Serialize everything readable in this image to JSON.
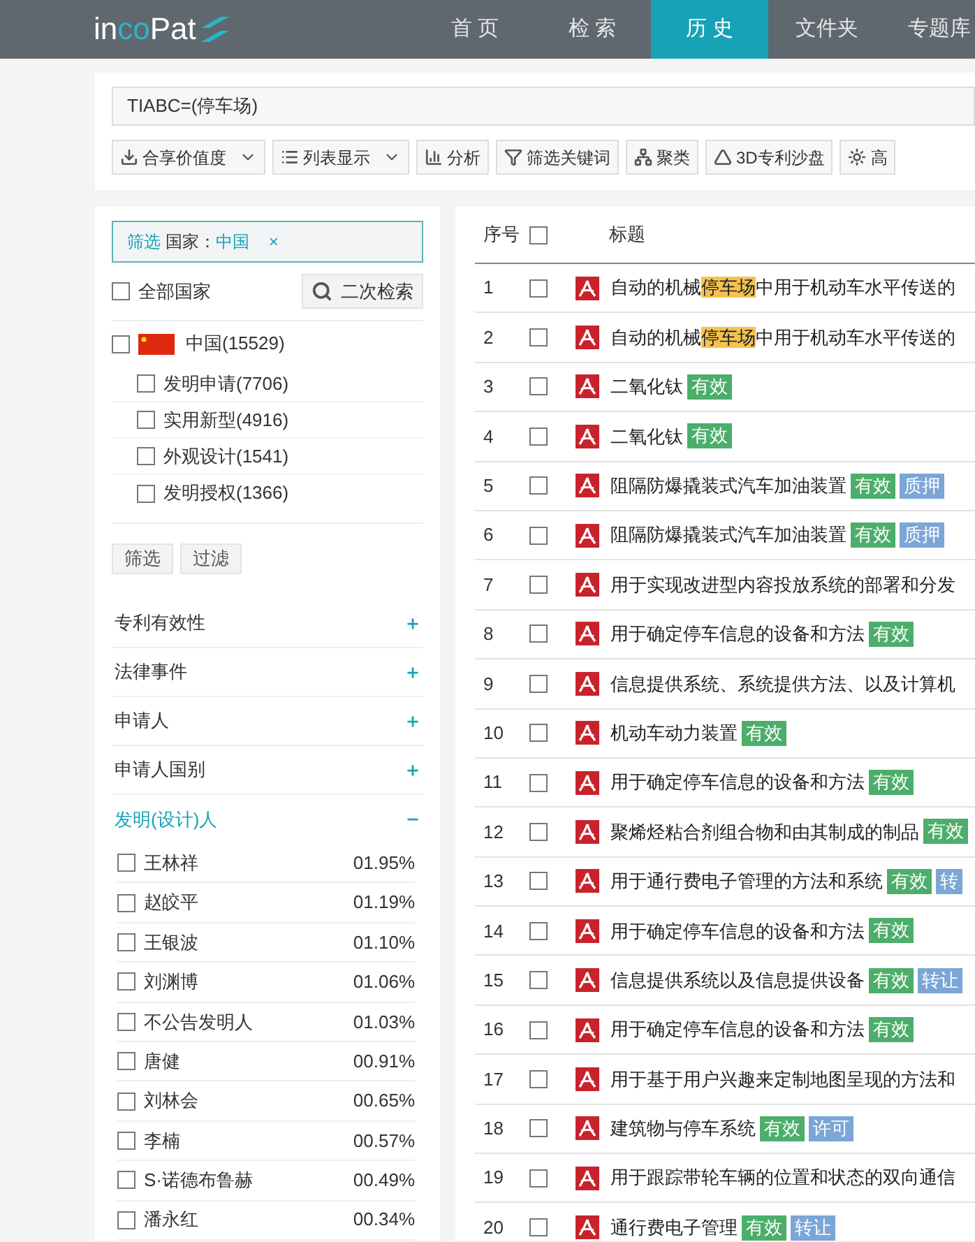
{
  "logo": [
    {
      "text": "in",
      "accent": false
    },
    {
      "text": "co",
      "accent": true
    },
    {
      "text": "Pat",
      "accent": false
    }
  ],
  "nav": [
    {
      "label": "首 页",
      "selected": false
    },
    {
      "label": "检 索",
      "selected": false
    },
    {
      "label": "历 史",
      "selected": true
    },
    {
      "label": "文件夹",
      "selected": false
    },
    {
      "label": "专题库",
      "selected": false
    }
  ],
  "query": "TIABC=(停车场)",
  "toolbar": [
    {
      "label": "合享价值度",
      "kind": "download",
      "dropdown": true
    },
    {
      "label": "列表显示",
      "kind": "list",
      "dropdown": true
    },
    {
      "label": "分析",
      "kind": "chart",
      "dropdown": false
    },
    {
      "label": "筛选关键词",
      "kind": "filter",
      "dropdown": false
    },
    {
      "label": "聚类",
      "kind": "tree",
      "dropdown": false
    },
    {
      "label": "3D专利沙盘",
      "kind": "sandbox",
      "dropdown": false
    },
    {
      "label": "高",
      "kind": "sun",
      "dropdown": false
    }
  ],
  "filter_chip": {
    "prefix": "筛选",
    "field": "国家：",
    "value": "中国",
    "close": "×"
  },
  "all_countries": {
    "label": "全部国家",
    "checked": false
  },
  "secondary_search": "二次检索",
  "countries": [
    {
      "name": "中国(15529)",
      "checked": false,
      "children": [
        {
          "name": "发明申请(7706)",
          "checked": false
        },
        {
          "name": "实用新型(4916)",
          "checked": false
        },
        {
          "name": "外观设计(1541)",
          "checked": false
        },
        {
          "name": "发明授权(1366)",
          "checked": false
        }
      ]
    }
  ],
  "filter_buttons": [
    "筛选",
    "过滤"
  ],
  "facets": [
    {
      "label": "专利有效性",
      "expanded": false
    },
    {
      "label": "法律事件",
      "expanded": false
    },
    {
      "label": "申请人",
      "expanded": false
    },
    {
      "label": "申请人国别",
      "expanded": false
    },
    {
      "label": "发明(设计)人",
      "expanded": true
    }
  ],
  "inventors": [
    {
      "name": "王林祥",
      "share": "01.95%",
      "checked": false
    },
    {
      "name": "赵皎平",
      "share": "01.19%",
      "checked": false
    },
    {
      "name": "王银波",
      "share": "01.10%",
      "checked": false
    },
    {
      "name": "刘渊博",
      "share": "01.06%",
      "checked": false
    },
    {
      "name": "不公告发明人",
      "share": "01.03%",
      "checked": false
    },
    {
      "name": "唐健",
      "share": "00.91%",
      "checked": false
    },
    {
      "name": "刘林会",
      "share": "00.65%",
      "checked": false
    },
    {
      "name": "李楠",
      "share": "00.57%",
      "checked": false
    },
    {
      "name": "S·诺德布鲁赫",
      "share": "00.49%",
      "checked": false
    },
    {
      "name": "潘永红",
      "share": "00.34%",
      "checked": false
    }
  ],
  "table": {
    "columns": [
      "序号",
      "标题"
    ],
    "select_all": false,
    "rows": [
      {
        "index": "1",
        "checked": false,
        "title": [
          {
            "text": "自动的机械",
            "highlight": false
          },
          {
            "text": "停车场",
            "highlight": true
          },
          {
            "text": "中用于机动车水平传送的",
            "highlight": false
          }
        ],
        "tags": []
      },
      {
        "index": "2",
        "checked": false,
        "title": [
          {
            "text": "自动的机械",
            "highlight": false
          },
          {
            "text": "停车场",
            "highlight": true
          },
          {
            "text": "中用于机动车水平传送的",
            "highlight": false
          }
        ],
        "tags": []
      },
      {
        "index": "3",
        "checked": false,
        "title": [
          {
            "text": "二氧化钛",
            "highlight": false
          }
        ],
        "tags": [
          {
            "label": "有效",
            "color": "#4cae6a"
          }
        ]
      },
      {
        "index": "4",
        "checked": false,
        "title": [
          {
            "text": "二氧化钛",
            "highlight": false
          }
        ],
        "tags": [
          {
            "label": "有效",
            "color": "#4cae6a"
          }
        ]
      },
      {
        "index": "5",
        "checked": false,
        "title": [
          {
            "text": "阻隔防爆撬装式汽车加油装置",
            "highlight": false
          }
        ],
        "tags": [
          {
            "label": "有效",
            "color": "#4cae6a"
          },
          {
            "label": "质押",
            "color": "#7ba6d6"
          }
        ]
      },
      {
        "index": "6",
        "checked": false,
        "title": [
          {
            "text": "阻隔防爆撬装式汽车加油装置",
            "highlight": false
          }
        ],
        "tags": [
          {
            "label": "有效",
            "color": "#4cae6a"
          },
          {
            "label": "质押",
            "color": "#7ba6d6"
          }
        ]
      },
      {
        "index": "7",
        "checked": false,
        "title": [
          {
            "text": "用于实现改进型内容投放系统的部署和分发",
            "highlight": false
          }
        ],
        "tags": []
      },
      {
        "index": "8",
        "checked": false,
        "title": [
          {
            "text": "用于确定停车信息的设备和方法",
            "highlight": false
          }
        ],
        "tags": [
          {
            "label": "有效",
            "color": "#4cae6a"
          }
        ]
      },
      {
        "index": "9",
        "checked": false,
        "title": [
          {
            "text": "信息提供系统、系统提供方法、以及计算机",
            "highlight": false
          }
        ],
        "tags": []
      },
      {
        "index": "10",
        "checked": false,
        "title": [
          {
            "text": "机动车动力装置",
            "highlight": false
          }
        ],
        "tags": [
          {
            "label": "有效",
            "color": "#4cae6a"
          }
        ]
      },
      {
        "index": "11",
        "checked": false,
        "title": [
          {
            "text": "用于确定停车信息的设备和方法",
            "highlight": false
          }
        ],
        "tags": [
          {
            "label": "有效",
            "color": "#4cae6a"
          }
        ]
      },
      {
        "index": "12",
        "checked": false,
        "title": [
          {
            "text": "聚烯烃粘合剂组合物和由其制成的制品",
            "highlight": false
          }
        ],
        "tags": [
          {
            "label": "有效",
            "color": "#4cae6a"
          }
        ]
      },
      {
        "index": "13",
        "checked": false,
        "title": [
          {
            "text": "用于通行费电子管理的方法和系统",
            "highlight": false
          }
        ],
        "tags": [
          {
            "label": "有效",
            "color": "#4cae6a"
          },
          {
            "label": "转",
            "color": "#7ba6d6"
          }
        ]
      },
      {
        "index": "14",
        "checked": false,
        "title": [
          {
            "text": "用于确定停车信息的设备和方法",
            "highlight": false
          }
        ],
        "tags": [
          {
            "label": "有效",
            "color": "#4cae6a"
          }
        ]
      },
      {
        "index": "15",
        "checked": false,
        "title": [
          {
            "text": "信息提供系统以及信息提供设备",
            "highlight": false
          }
        ],
        "tags": [
          {
            "label": "有效",
            "color": "#4cae6a"
          },
          {
            "label": "转让",
            "color": "#7ba6d6"
          }
        ]
      },
      {
        "index": "16",
        "checked": false,
        "title": [
          {
            "text": "用于确定停车信息的设备和方法",
            "highlight": false
          }
        ],
        "tags": [
          {
            "label": "有效",
            "color": "#4cae6a"
          }
        ]
      },
      {
        "index": "17",
        "checked": false,
        "title": [
          {
            "text": "用于基于用户兴趣来定制地图呈现的方法和",
            "highlight": false
          }
        ],
        "tags": []
      },
      {
        "index": "18",
        "checked": false,
        "title": [
          {
            "text": "建筑物与停车系统",
            "highlight": false
          }
        ],
        "tags": [
          {
            "label": "有效",
            "color": "#4cae6a"
          },
          {
            "label": "许可",
            "color": "#7ba6d6"
          }
        ]
      },
      {
        "index": "19",
        "checked": false,
        "title": [
          {
            "text": "用于跟踪带轮车辆的位置和状态的双向通信",
            "highlight": false
          }
        ],
        "tags": []
      },
      {
        "index": "20",
        "checked": false,
        "title": [
          {
            "text": "通行费电子管理",
            "highlight": false
          }
        ],
        "tags": [
          {
            "label": "有效",
            "color": "#4cae6a"
          },
          {
            "label": "转让",
            "color": "#7ba6d6"
          }
        ]
      }
    ]
  }
}
